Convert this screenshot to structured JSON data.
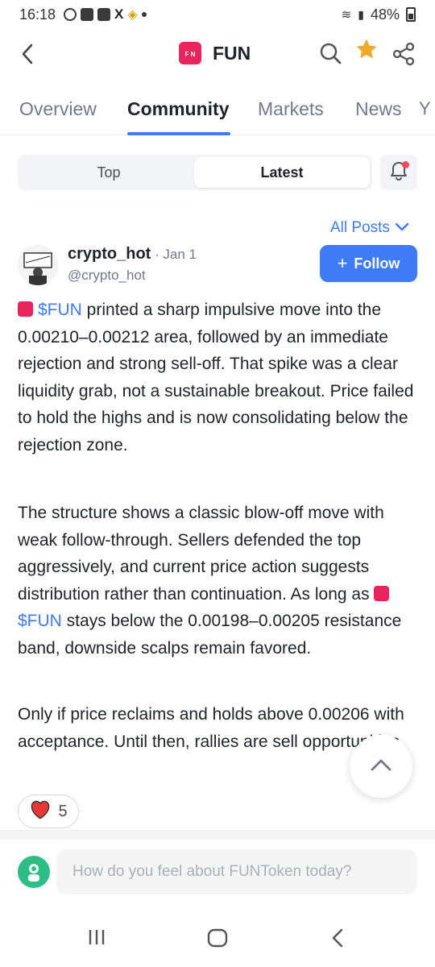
{
  "status": {
    "time": "16:18",
    "battery": "48%"
  },
  "header": {
    "title": "FUN",
    "token_logo_text": "F N"
  },
  "tabs": [
    {
      "label": "Overview"
    },
    {
      "label": "Community"
    },
    {
      "label": "Markets"
    },
    {
      "label": "News"
    }
  ],
  "segment": {
    "top_label": "Top",
    "latest_label": "Latest"
  },
  "filter": {
    "label": "All Posts"
  },
  "post": {
    "username": "crypto_hot",
    "date": "· Jan 1",
    "handle": "@crypto_hot",
    "follow_label": "Follow",
    "cashtag": "$FUN",
    "p1_text": " printed a sharp impulsive move into the 0.00210–0.00212 area, followed by an immediate rejection and strong sell-off. That spike was a clear liquidity grab, not a sustainable breakout. Price failed to hold the highs and is now consolidating below the rejection zone.",
    "p2_before": "The structure shows a classic blow-off move with weak follow-through. Sellers defended the top aggressively, and current price action suggests distribution rather than continuation. As long as ",
    "p2_after": " stays below the 0.00198–0.00205 resistance band, downside scalps remain favored.",
    "p3_text": "Only if price reclaims and holds above 0.00206 with acceptance. Until then, rallies are sell opportunities.",
    "reaction_count": "5"
  },
  "compose": {
    "placeholder": "How do you feel about FUNToken today?"
  },
  "colors": {
    "accent": "#3f7bf5",
    "token": "#e8245d",
    "star": "#f0a92a",
    "heart": "#e53935",
    "notify_dot": "#f6465d"
  }
}
